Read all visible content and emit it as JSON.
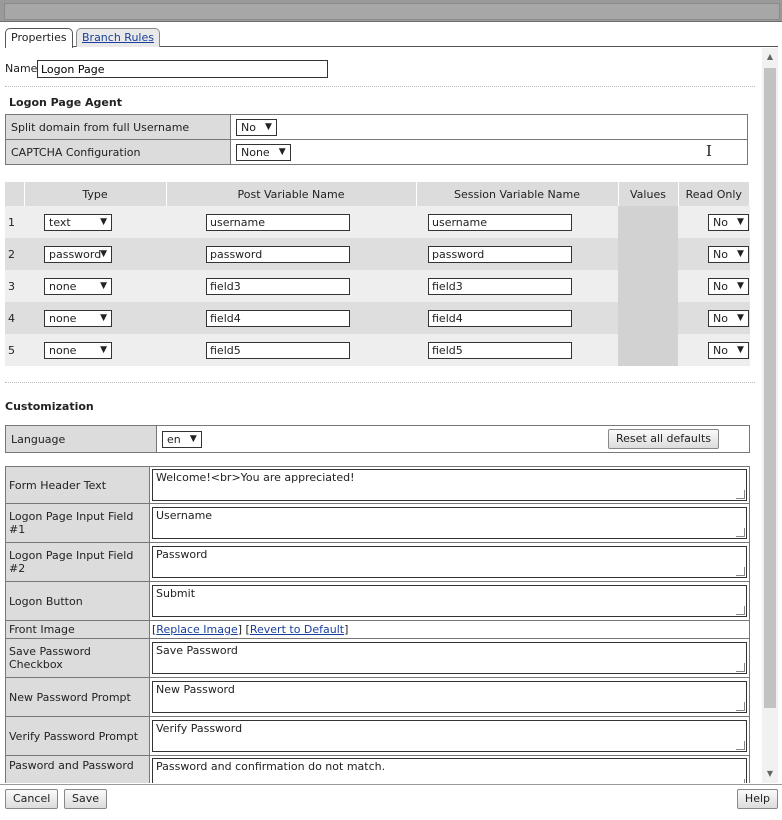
{
  "tabs": [
    {
      "label": "Properties",
      "active": true
    },
    {
      "label": "Branch Rules",
      "active": false
    }
  ],
  "name": {
    "label": "Name:",
    "value": "Logon Page"
  },
  "agent": {
    "title": "Logon Page Agent",
    "rows": [
      {
        "label": "Split domain from full Username",
        "value": "No"
      },
      {
        "label": "CAPTCHA Configuration",
        "value": "None"
      }
    ]
  },
  "variables": {
    "headers": {
      "type": "Type",
      "post": "Post Variable Name",
      "session": "Session Variable Name",
      "values": "Values",
      "readonly": "Read Only"
    },
    "rows": [
      {
        "idx": "1",
        "type": "text",
        "post": "username",
        "session": "username",
        "readonly": "No"
      },
      {
        "idx": "2",
        "type": "password",
        "post": "password",
        "session": "password",
        "readonly": "No"
      },
      {
        "idx": "3",
        "type": "none",
        "post": "field3",
        "session": "field3",
        "readonly": "No"
      },
      {
        "idx": "4",
        "type": "none",
        "post": "field4",
        "session": "field4",
        "readonly": "No"
      },
      {
        "idx": "5",
        "type": "none",
        "post": "field5",
        "session": "field5",
        "readonly": "No"
      }
    ]
  },
  "customization": {
    "title": "Customization",
    "language": {
      "label": "Language",
      "value": "en",
      "reset_label": "Reset all defaults"
    },
    "fields": [
      {
        "label": "Form Header Text",
        "value": "Welcome!<br>You are appreciated!"
      },
      {
        "label": "Logon Page Input Field #1",
        "value": "Username"
      },
      {
        "label": "Logon Page Input Field #2",
        "value": "Password"
      },
      {
        "label": "Logon Button",
        "value": "Submit"
      }
    ],
    "front_image": {
      "label": "Front Image",
      "replace": "Replace Image",
      "revert": "Revert to Default"
    },
    "fields2": [
      {
        "label": "Save Password Checkbox",
        "value": "Save Password"
      },
      {
        "label": "New Password Prompt",
        "value": "New Password"
      },
      {
        "label": "Verify Password Prompt",
        "value": "Verify Password"
      },
      {
        "label": "Pasword and Password",
        "value": "Password and confirmation do not match."
      }
    ]
  },
  "footer": {
    "cancel": "Cancel",
    "save": "Save",
    "help": "Help"
  },
  "icons": {
    "dropdown": "▼",
    "scroll_up": "▲",
    "scroll_down": "▼",
    "cursor": "I-beam-icon"
  }
}
